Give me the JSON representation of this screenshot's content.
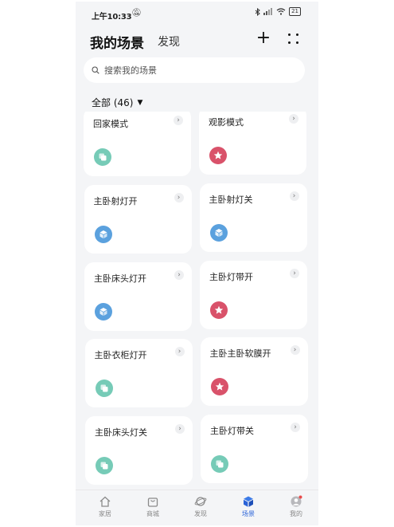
{
  "status_bar": {
    "time": "上午10:33",
    "battery": "21"
  },
  "header": {
    "title": "我的场景",
    "tab": "发现",
    "add": "+"
  },
  "search": {
    "placeholder": "搜索我的场景"
  },
  "filter": {
    "label": "全部 (46)",
    "caret": "▼"
  },
  "scenes": [
    {
      "name": "回家模式",
      "icon": "copy-icon",
      "color": "#76cbb7"
    },
    {
      "name": "观影模式",
      "icon": "star-icon",
      "color": "#d9526a"
    },
    {
      "name": "主卧射灯开",
      "icon": "cube-icon",
      "color": "#5ba1de"
    },
    {
      "name": "主卧射灯关",
      "icon": "cube-icon",
      "color": "#5ba1de"
    },
    {
      "name": "主卧床头灯开",
      "icon": "cube-icon",
      "color": "#5ba1de"
    },
    {
      "name": "主卧灯带开",
      "icon": "star-icon",
      "color": "#d9526a"
    },
    {
      "name": "主卧衣柜灯开",
      "icon": "copy-icon",
      "color": "#76cbb7"
    },
    {
      "name": "主卧主卧软膜开",
      "icon": "star-icon",
      "color": "#d9526a"
    },
    {
      "name": "主卧床头灯关",
      "icon": "copy-icon",
      "color": "#76cbb7"
    },
    {
      "name": "主卧灯带关",
      "icon": "copy-icon",
      "color": "#76cbb7"
    }
  ],
  "tabs": [
    {
      "label": "家居",
      "icon": "home-icon",
      "active": false
    },
    {
      "label": "商城",
      "icon": "shopping-bag-icon",
      "active": false
    },
    {
      "label": "发现",
      "icon": "planet-icon",
      "active": false
    },
    {
      "label": "场景",
      "icon": "cube-icon",
      "active": true
    },
    {
      "label": "我的",
      "icon": "avatar-icon",
      "active": false
    }
  ],
  "colors": {
    "accent": "#2a63d8",
    "notification_dot": "#e84a4a"
  }
}
